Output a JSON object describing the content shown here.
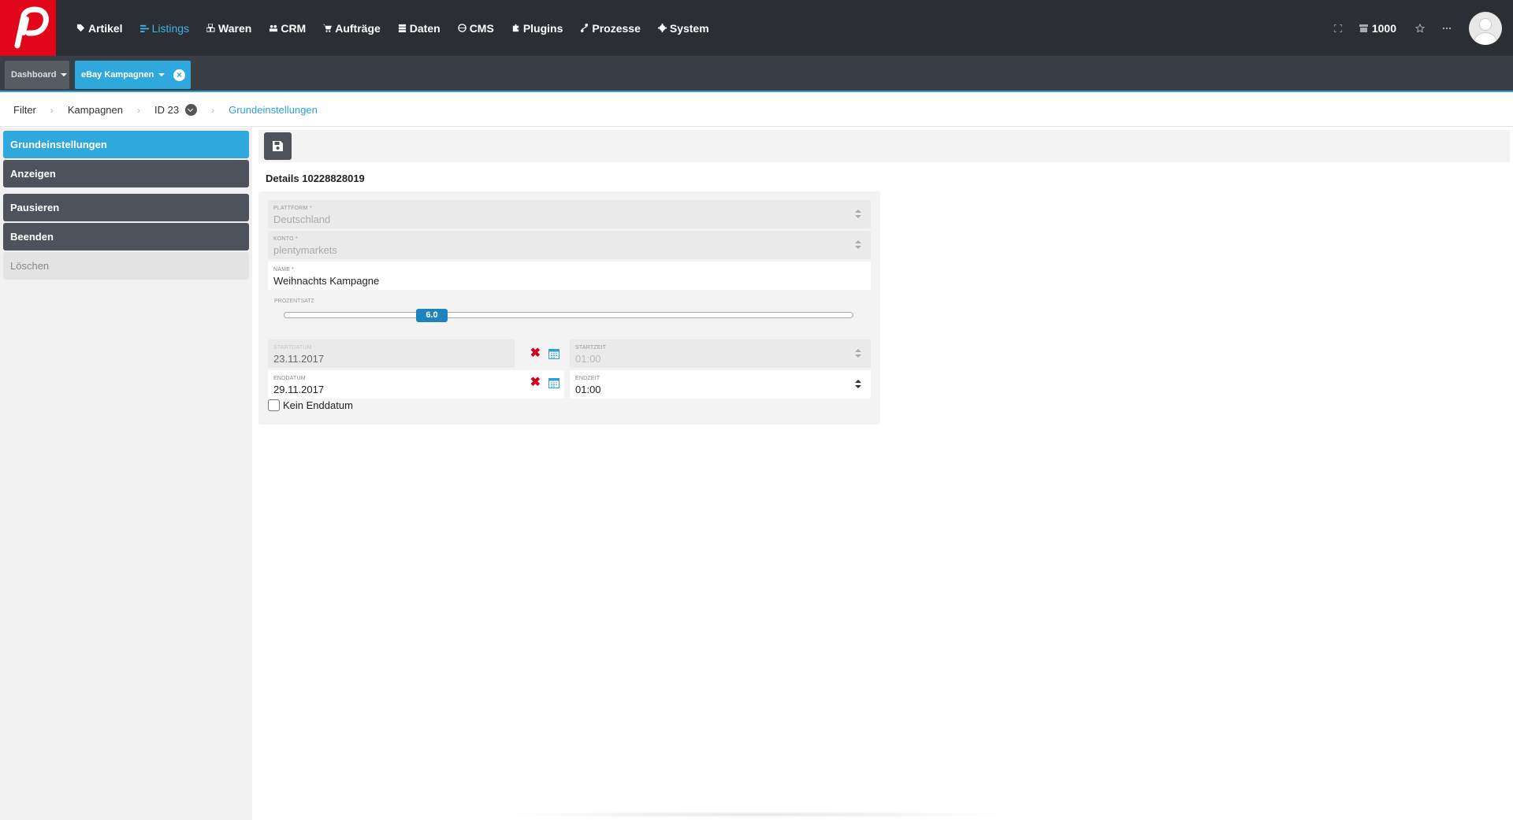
{
  "nav": {
    "items": [
      {
        "label": "Artikel",
        "icon": "tag-icon",
        "active": false
      },
      {
        "label": "Listings",
        "icon": "list-icon",
        "active": true
      },
      {
        "label": "Waren",
        "icon": "boxes-icon",
        "active": false
      },
      {
        "label": "CRM",
        "icon": "users-icon",
        "active": false
      },
      {
        "label": "Aufträge",
        "icon": "cart-icon",
        "active": false
      },
      {
        "label": "Daten",
        "icon": "database-icon",
        "active": false
      },
      {
        "label": "CMS",
        "icon": "globe-icon",
        "active": false
      },
      {
        "label": "Plugins",
        "icon": "puzzle-icon",
        "active": false
      },
      {
        "label": "Prozesse",
        "icon": "process-icon",
        "active": false
      },
      {
        "label": "System",
        "icon": "gear-icon",
        "active": false
      }
    ],
    "counter": "1000",
    "icons": [
      "expand-icon",
      "store-icon",
      "star-icon",
      "more-icon",
      "avatar"
    ]
  },
  "tabs": {
    "dashboard": "Dashboard",
    "ebay": "eBay Kampagnen"
  },
  "breadcrumb": {
    "filter": "Filter",
    "campaigns": "Kampagnen",
    "id": "ID 23",
    "current": "Grundeinstellungen"
  },
  "sidebar": {
    "items": [
      {
        "label": "Grundeinstellungen",
        "state": "active"
      },
      {
        "label": "Anzeigen",
        "state": "dark"
      },
      {
        "label": "Pausieren",
        "state": "dark"
      },
      {
        "label": "Beenden",
        "state": "dark"
      },
      {
        "label": "Löschen",
        "state": "disabled"
      }
    ]
  },
  "main": {
    "details_title": "Details 10228828019",
    "form": {
      "platform": {
        "label": "Plattform *",
        "value": "Deutschland"
      },
      "account": {
        "label": "Konto *",
        "value": "plentymarkets"
      },
      "name": {
        "label": "Name *",
        "value": "Weihnachts Kampagne"
      },
      "percentage": {
        "label": "Prozentsatz",
        "value": "6.0",
        "fraction": 0.26
      },
      "start_date": {
        "label": "Startdatum",
        "value": "23.11.2017"
      },
      "start_time": {
        "label": "Startzeit",
        "value": "01:00"
      },
      "end_date": {
        "label": "Enddatum",
        "value": "29.11.2017"
      },
      "end_time": {
        "label": "Endzeit",
        "value": "01:00"
      },
      "no_end_date": {
        "label": "Kein Enddatum",
        "checked": false
      }
    }
  },
  "colors": {
    "brand_red": "#e2061b",
    "accent_blue": "#2fa8dd",
    "topbar": "#2b2f33",
    "dark_button": "#4e535b"
  }
}
